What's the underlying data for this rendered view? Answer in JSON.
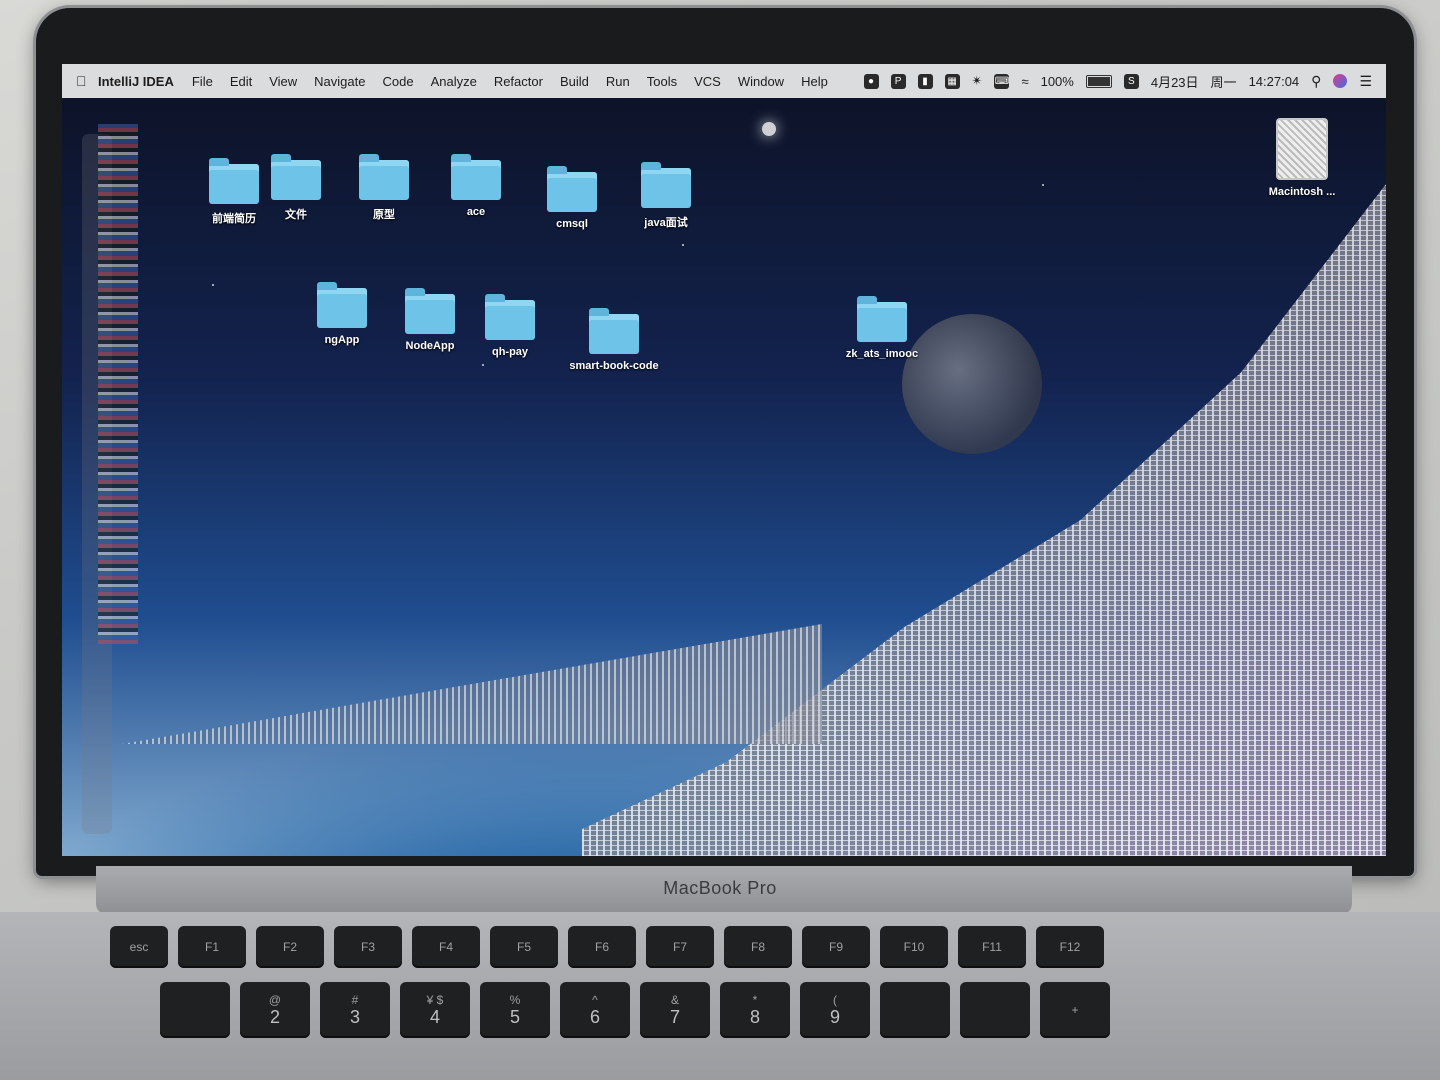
{
  "menubar": {
    "app_name": "IntelliJ IDEA",
    "menus": [
      "File",
      "Edit",
      "View",
      "Navigate",
      "Code",
      "Analyze",
      "Refactor",
      "Build",
      "Run",
      "Tools",
      "VCS",
      "Window",
      "Help"
    ],
    "battery_percent": "100%",
    "date": "4月23日",
    "weekday": "周一",
    "time": "14:27:04"
  },
  "desktop": {
    "row1": [
      "前端简历",
      "文件",
      "原型",
      "ace",
      "cmsql",
      "java面试"
    ],
    "row2": [
      "ngApp",
      "NodeApp",
      "qh-pay",
      "smart-book-code"
    ],
    "extra_folder": "zk_ats_imooc",
    "drive": "Macintosh ..."
  },
  "hardware": {
    "brand": "MacBook Pro",
    "keys_row1": [
      "esc",
      "F1",
      "F2",
      "F3",
      "F4",
      "F5",
      "F6",
      "F7",
      "F8",
      "F9",
      "F10",
      "F11",
      "F12"
    ],
    "keys_row2": [
      {
        "top": "",
        "main": ""
      },
      {
        "top": "@",
        "main": "2"
      },
      {
        "top": "#",
        "main": "3"
      },
      {
        "top": "¥ $",
        "main": "4"
      },
      {
        "top": "%",
        "main": "5"
      },
      {
        "top": "^",
        "main": "6"
      },
      {
        "top": "&",
        "main": "7"
      },
      {
        "top": "*",
        "main": "8"
      },
      {
        "top": "(",
        "main": "9"
      },
      {
        "top": "",
        "main": ""
      },
      {
        "top": "",
        "main": ""
      },
      {
        "top": "+",
        "main": ""
      }
    ]
  },
  "colors": {
    "folder": "#6ec3e8",
    "menubar_bg": "#ececec",
    "bezel": "#1a1b1d"
  }
}
